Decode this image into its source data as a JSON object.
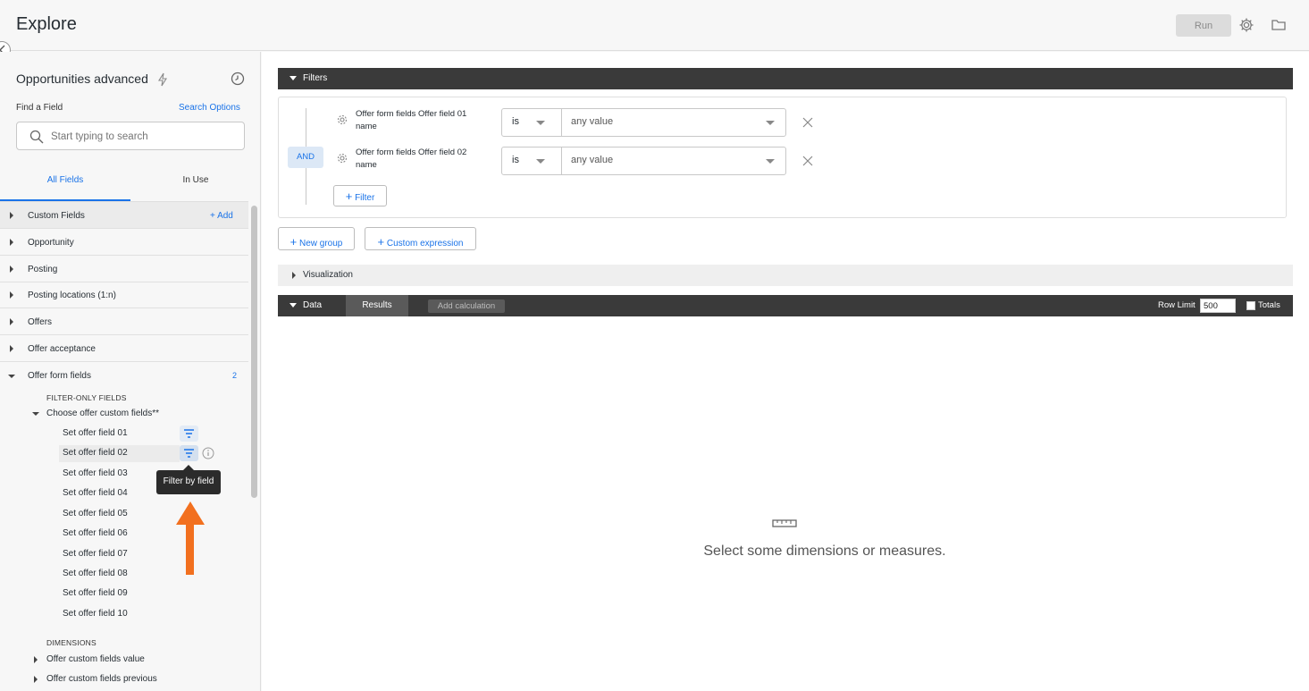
{
  "header": {
    "title": "Explore",
    "run_label": "Run"
  },
  "sidebar": {
    "model_name": "Opportunities advanced",
    "find_label": "Find a Field",
    "search_options_label": "Search Options",
    "search_placeholder": "Start typing to search",
    "tabs": [
      "All Fields",
      "In Use"
    ],
    "views": [
      {
        "label": "Custom Fields",
        "action": "+ Add"
      },
      {
        "label": "Opportunity"
      },
      {
        "label": "Posting"
      },
      {
        "label": "Posting locations (1:n)"
      },
      {
        "label": "Offers"
      },
      {
        "label": "Offer acceptance"
      },
      {
        "label": "Offer form fields",
        "count": "2"
      }
    ],
    "filter_only_label": "FILTER-ONLY FIELDS",
    "group_label": "Choose offer custom fields**",
    "leaf_fields": [
      "Set offer field 01",
      "Set offer field 02",
      "Set offer field 03",
      "Set offer field 04",
      "Set offer field 05",
      "Set offer field 06",
      "Set offer field 07",
      "Set offer field 08",
      "Set offer field 09",
      "Set offer field 10"
    ],
    "dimensions_label": "DIMENSIONS",
    "dimension_groups": [
      "Offer custom fields value",
      "Offer custom fields previous"
    ],
    "tooltip": "Filter by field"
  },
  "filters": {
    "section_label": "Filters",
    "logic": "AND",
    "conditions": [
      {
        "field": "Offer form fields Offer field 01 name",
        "operator": "is",
        "value": "any value"
      },
      {
        "field": "Offer form fields Offer field 02 name",
        "operator": "is",
        "value": "any value"
      }
    ],
    "add_filter_label": "Filter",
    "new_group_label": "New group",
    "custom_expression_label": "Custom expression"
  },
  "visualization": {
    "label": "Visualization"
  },
  "data": {
    "label": "Data",
    "results_tab": "Results",
    "add_calculation": "Add calculation",
    "row_limit_label": "Row Limit",
    "row_limit_value": "500",
    "totals_label": "Totals",
    "empty_message": "Select some dimensions or measures."
  },
  "colors": {
    "accent": "#1a73e8",
    "dark_bar": "#3a3a3a",
    "annotation_arrow": "#f2701f"
  }
}
